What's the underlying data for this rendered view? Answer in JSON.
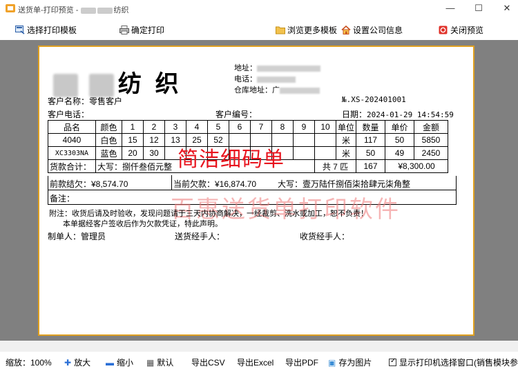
{
  "window": {
    "title_prefix": "送货单-打印预览 - ",
    "title_suffix": "纺织",
    "min": "—",
    "max": "☐",
    "close": "✕"
  },
  "toolbar": {
    "select_template": "选择打印模板",
    "confirm_print": "确定打印",
    "browse_templates": "浏览更多模板",
    "company_settings": "设置公司信息",
    "close_preview": "关闭预览"
  },
  "doc": {
    "company_name": "纺 织",
    "address_label": "地址：",
    "phone_label": "电话：",
    "warehouse_label": "仓库地址：",
    "warehouse_prefix": "广",
    "customer_name_label": "客户名称：",
    "customer_name": "零售客户",
    "order_no": "№.XS-202401001",
    "customer_phone_label": "客户电话：",
    "customer_code_label": "客户编号：",
    "date_label": "日期：",
    "date": "2024-01-29 14:54:59",
    "headers": [
      "品名",
      "颜色",
      "1",
      "2",
      "3",
      "4",
      "5",
      "6",
      "7",
      "8",
      "9",
      "10",
      "单位",
      "数量",
      "单价",
      "金额"
    ],
    "rows": [
      [
        "4040",
        "白色",
        "15",
        "12",
        "13",
        "25",
        "52",
        "",
        "",
        "",
        "",
        "",
        "米",
        "117",
        "50",
        "5850"
      ],
      [
        "XC3303NA",
        "蓝色",
        "20",
        "30",
        "",
        "",
        "",
        "",
        "",
        "",
        "",
        "",
        "米",
        "50",
        "49",
        "2450"
      ]
    ],
    "total_label": "货款合计：",
    "total_upper": "大写：捌仟叁佰元整",
    "total_count": "共 7 匹",
    "total_qty": "167",
    "total_amount": "¥8,300.00",
    "prev_debt": "前款结欠：¥8,574.70",
    "current_debt": "当前欠款：¥16,874.70",
    "current_debt_upper": "大写：壹万陆仟捌佰柒拾肆元柒角整",
    "remark": "备注：",
    "stamp": "简洁细码单",
    "watermark": "百惠送货单打印软件",
    "note1": "附注：收货后请及时验收，发现问题请于三天内协商解决，一经裁剪、洗水或加工，恕不负责！",
    "note2": "本单据经客户签收后作为欠款凭证，特此声明。",
    "maker": "制单人：管理员",
    "shipper": "送货经手人：",
    "receiver": "收货经手人："
  },
  "status": {
    "zoom": "缩放：100%",
    "zoom_in": "放大",
    "zoom_out": "缩小",
    "default": "默认",
    "export_csv": "导出CSV",
    "export_excel": "导出Excel",
    "export_pdf": "导出PDF",
    "save_image": "存为图片",
    "show_printer": "显示打印机选择窗口(销售模块参数"
  },
  "colors": {
    "stamp_red": "#e8141e",
    "paper_border": "#e0a020",
    "preview_bg": "#808080"
  }
}
